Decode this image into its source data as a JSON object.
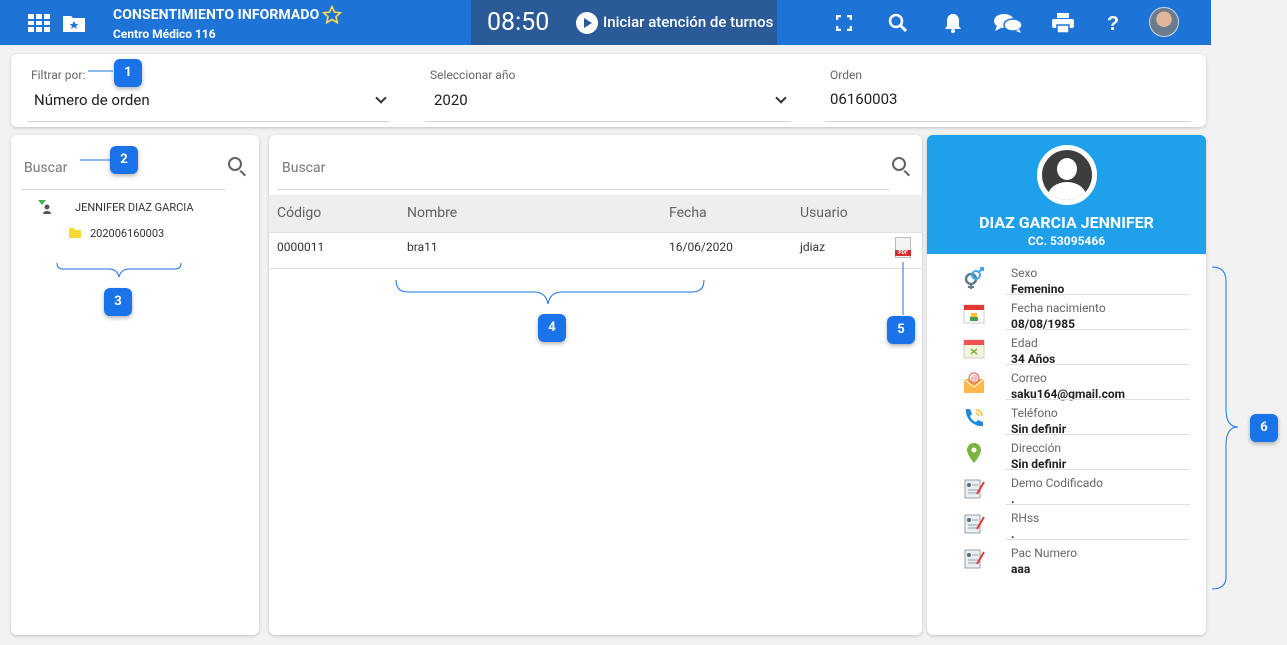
{
  "header": {
    "title": "CONSENTIMIENTO INFORMADO",
    "subtitle": "Centro Médico 116",
    "clock": "08:50",
    "start_label": "Iniciar atención de turnos",
    "icons": [
      "grid-icon",
      "folder-star-icon",
      "star-icon",
      "play-icon",
      "fullscreen-icon",
      "search-icon",
      "bell-icon",
      "chat-icon",
      "print-icon",
      "help-icon",
      "avatar"
    ]
  },
  "filters": {
    "filter_label": "Filtrar por:",
    "filter_value": "Número de orden",
    "year_label": "Seleccionar año",
    "year_value": "2020",
    "order_label": "Orden",
    "order_value": "06160003"
  },
  "left": {
    "search_placeholder": "Buscar",
    "patient": "JENNIFER DIAZ GARCIA",
    "order": "202006160003"
  },
  "table": {
    "search_placeholder": "Buscar",
    "columns": [
      "Código",
      "Nombre",
      "Fecha",
      "Usuario"
    ],
    "rows": [
      {
        "codigo": "0000011",
        "nombre": "bra11",
        "fecha": "16/06/2020",
        "usuario": "jdiaz"
      }
    ]
  },
  "patient": {
    "name": "DIAZ GARCIA JENNIFER",
    "id": "CC. 53095466",
    "fields": [
      {
        "label": "Sexo",
        "value": "Femenino",
        "icon": "gender-icon"
      },
      {
        "label": "Fecha nacimiento",
        "value": "08/08/1985",
        "icon": "calendar-birth-icon"
      },
      {
        "label": "Edad",
        "value": "34 Años",
        "icon": "calendar-icon"
      },
      {
        "label": "Correo",
        "value": "saku164@gmail.com",
        "icon": "mail-icon"
      },
      {
        "label": "Teléfono",
        "value": "Sin definir",
        "icon": "phone-icon"
      },
      {
        "label": "Dirección",
        "value": "Sin definir",
        "icon": "location-icon"
      },
      {
        "label": "Demo Codificado",
        "value": ".",
        "icon": "form-icon"
      },
      {
        "label": "RHss",
        "value": ".",
        "icon": "form-icon"
      },
      {
        "label": "Pac Numero",
        "value": "aaa",
        "icon": "form-icon"
      }
    ]
  },
  "annotations": [
    "1",
    "2",
    "3",
    "4",
    "5",
    "6"
  ],
  "colors": {
    "primary": "#1e74d6",
    "clock_bg": "#2a5a97",
    "patient_header": "#1ea0ea",
    "badge": "#1a73e8"
  }
}
